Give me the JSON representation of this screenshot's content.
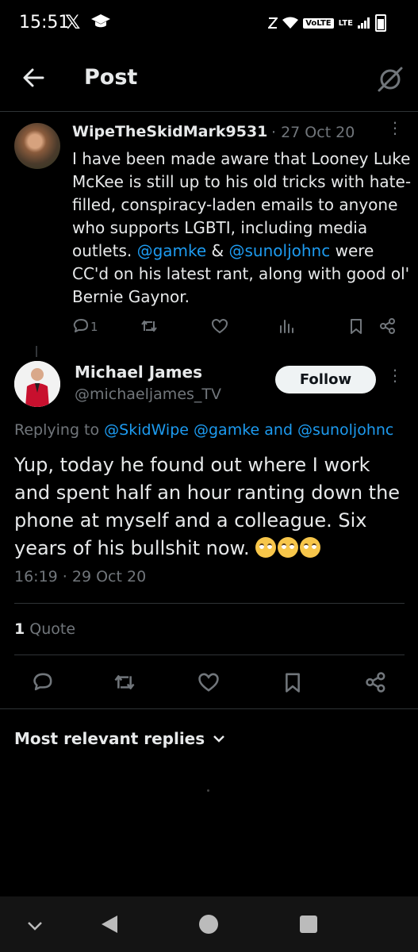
{
  "status_bar": {
    "time": "15:51",
    "x_logo": "𝕏",
    "volte": "VoLTE",
    "lte": "LTE"
  },
  "header": {
    "title": "Post"
  },
  "parent_tweet": {
    "display_name": "WipeTheSkidMark9531",
    "date": "· 27 Oct 20",
    "text_parts": [
      "I have been made aware that Looney Luke McKee is still up to his old tricks with hate-filled, conspiracy-laden emails to anyone who supports LGBTI, including media outlets. ",
      "@gamke",
      " & ",
      "@sunoljohnc",
      " were  CC'd on his latest rant, along with good ol' Bernie Gaynor."
    ],
    "reply_count": "1"
  },
  "main_tweet": {
    "display_name": "Michael James",
    "handle": "@michaeljames_TV",
    "follow_label": "Follow",
    "replying_prefix": "Replying to ",
    "replying_handles": "@SkidWipe @gamke and @sunoljohnc",
    "text": "Yup, today he found out where I work and spent half an hour ranting down the phone at myself and a colleague. Six years of his bullshit now. ",
    "emoji_count": 3,
    "timestamp": "16:19 · 29 Oct 20",
    "quote_count": "1",
    "quote_label": "Quote"
  },
  "replies_sort": {
    "label": "Most relevant replies"
  },
  "colors": {
    "background": "#000000",
    "text": "#e7e9ea",
    "secondary": "#71767b",
    "link": "#1d9bf0",
    "divider": "#2f3336"
  },
  "icons": [
    "back-arrow-icon",
    "grok-icon",
    "reply-icon",
    "retweet-icon",
    "like-icon",
    "views-icon",
    "bookmark-icon",
    "share-icon",
    "more-icon",
    "chevron-down-icon",
    "nav-back-icon",
    "nav-home-icon",
    "nav-recents-icon"
  ]
}
